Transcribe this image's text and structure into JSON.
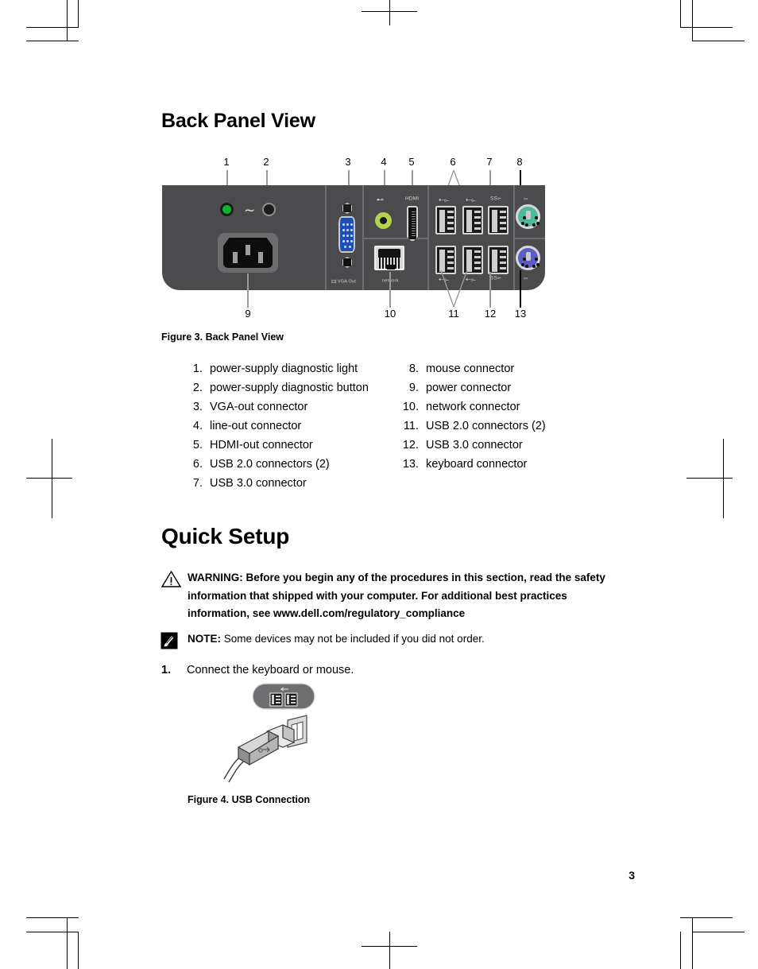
{
  "document": {
    "page_number": "3"
  },
  "sections": {
    "back_panel": {
      "title": "Back Panel View",
      "figure_caption": "Figure 3. Back Panel View",
      "callouts_top": [
        "1",
        "2",
        "3",
        "4",
        "5",
        "6",
        "7",
        "8"
      ],
      "callouts_bottom": [
        "9",
        "10",
        "11",
        "12",
        "13"
      ],
      "panel_labels": {
        "vga_out": "VGA Out",
        "network": "network",
        "usb20": "usb 2.0",
        "usb30": "SS",
        "line_out": "line-out",
        "hdmi": "HDMI",
        "mouse": "mouse",
        "keyboard": "keyboard"
      },
      "legend_left": [
        {
          "num": "1.",
          "text": "power-supply diagnostic light"
        },
        {
          "num": "2.",
          "text": "power-supply diagnostic button"
        },
        {
          "num": "3.",
          "text": "VGA-out connector"
        },
        {
          "num": "4.",
          "text": "line-out connector"
        },
        {
          "num": "5.",
          "text": "HDMI-out connector"
        },
        {
          "num": "6.",
          "text": "USB 2.0 connectors (2)"
        },
        {
          "num": "7.",
          "text": "USB 3.0 connector"
        }
      ],
      "legend_right": [
        {
          "num": "8.",
          "text": "mouse connector"
        },
        {
          "num": "9.",
          "text": "power connector"
        },
        {
          "num": "10.",
          "text": "network connector"
        },
        {
          "num": "11.",
          "text": "USB 2.0 connectors (2)"
        },
        {
          "num": "12.",
          "text": "USB 3.0 connector"
        },
        {
          "num": "13.",
          "text": "keyboard connector"
        }
      ]
    },
    "quick_setup": {
      "title": "Quick Setup",
      "warning": {
        "label": "WARNING:",
        "text": "Before you begin any of the procedures in this section, read the safety information that shipped with your computer. For additional best practices information, see www.dell.com/regulatory_compliance"
      },
      "note": {
        "label": "NOTE:",
        "text": "Some devices may not be included if you did not order."
      },
      "steps": [
        {
          "num": "1.",
          "text": "Connect the keyboard or mouse."
        }
      ],
      "figure_caption": "Figure 4. USB Connection"
    }
  },
  "colors": {
    "panel": "#4b4b4d",
    "panel_divider": "#6e6e70",
    "led_green": "#12b232",
    "vga_blue": "#1f4fb0",
    "line_out_green": "#b5d34b",
    "ps2_mouse_green": "#4db89a",
    "ps2_keyboard_purple": "#5a5ec2",
    "leader_line": "#9a9a9a",
    "text": "#000000"
  }
}
